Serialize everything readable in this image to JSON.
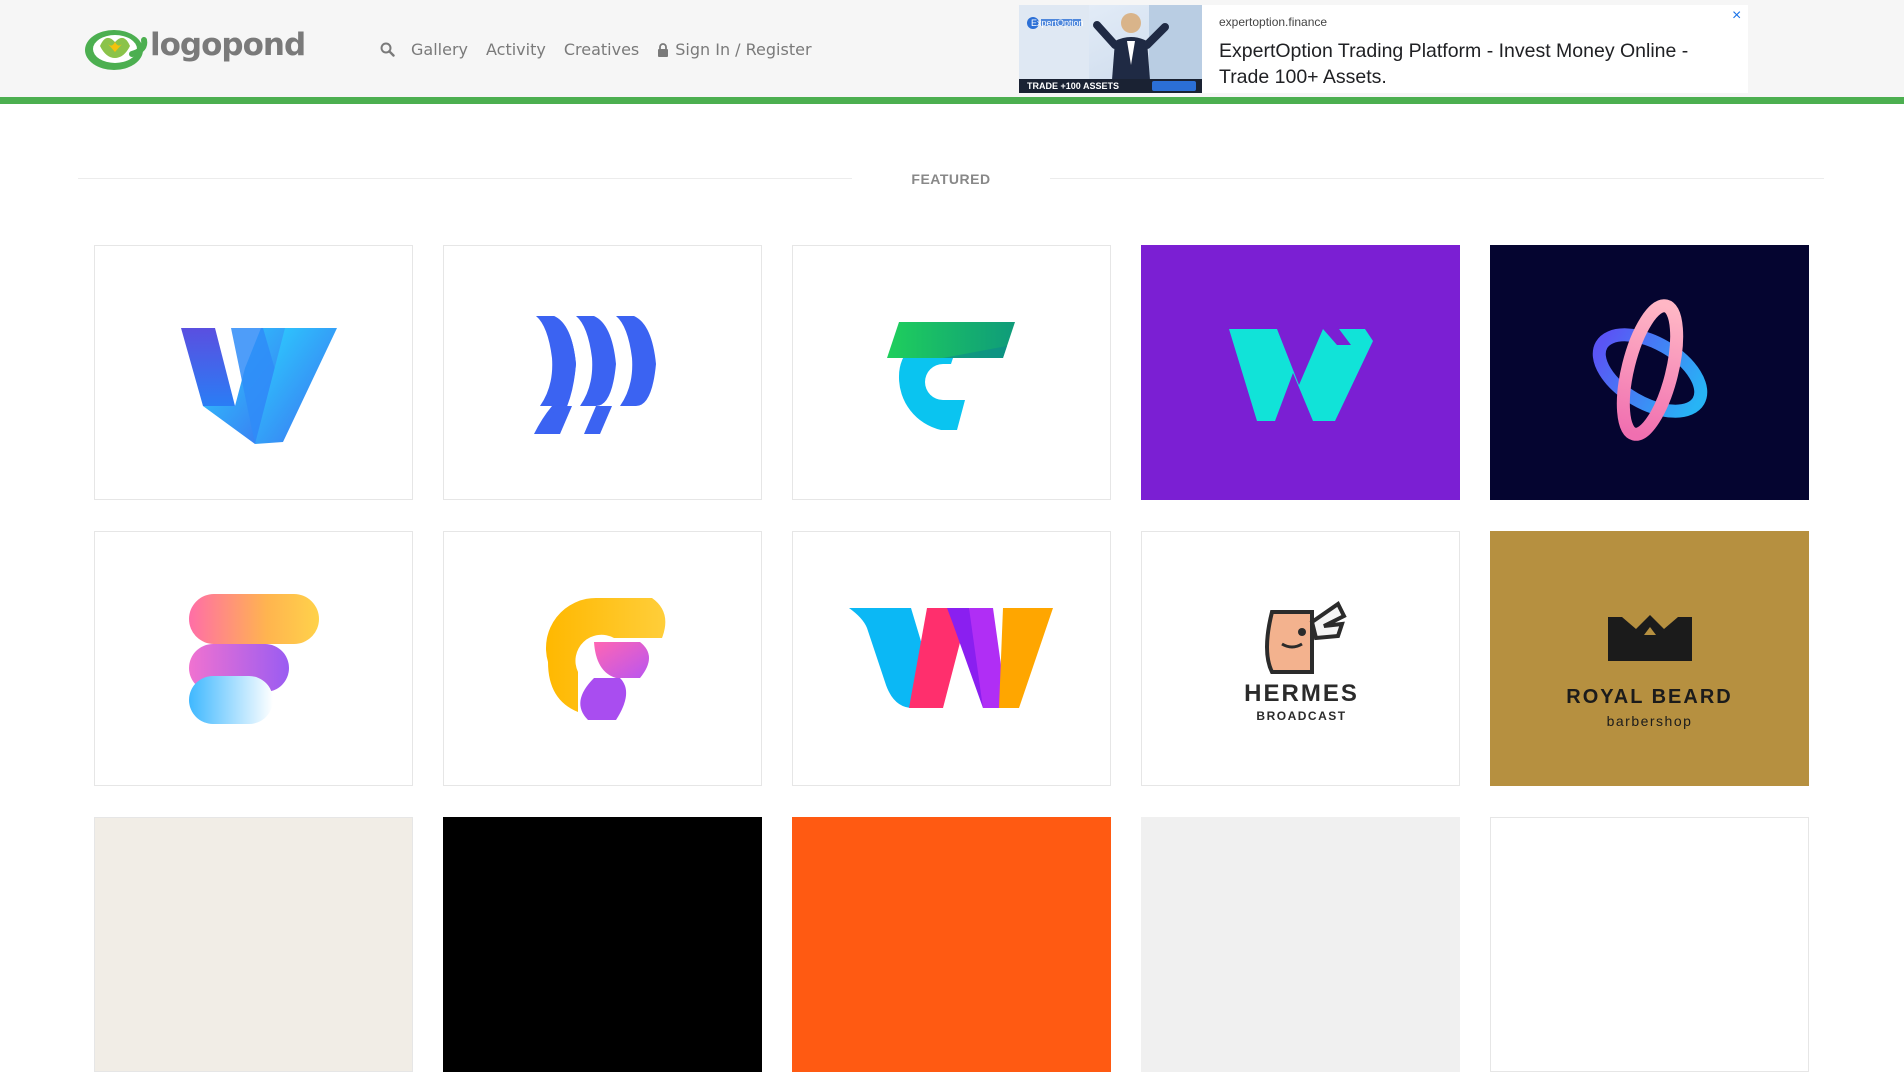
{
  "header": {
    "logo_text": "logopond",
    "nav": {
      "gallery": "Gallery",
      "activity": "Activity",
      "creatives": "Creatives",
      "sign_in": "Sign In / Register"
    },
    "accent_color": "#4caf50"
  },
  "ad": {
    "brand": "ExpertOption",
    "image_caption": "TRADE +100 ASSETS",
    "domain": "expertoption.finance",
    "title": "ExpertOption Trading Platform - Invest Money Online - Trade 100+ Assets.",
    "close_icon": "×"
  },
  "section": {
    "title": "FEATURED"
  },
  "logos": [
    {
      "name": "blue-w-ribbon-logo",
      "background": "#ffffff"
    },
    {
      "name": "blue-stripes-logo",
      "background": "#ffffff"
    },
    {
      "name": "green-cyan-c-logo",
      "background": "#ffffff"
    },
    {
      "name": "cyan-w-on-purple-logo",
      "background": "#7b1fd3"
    },
    {
      "name": "pink-blue-orbit-logo",
      "background": "#050530"
    },
    {
      "name": "gradient-f-logo",
      "background": "#ffffff"
    },
    {
      "name": "yellow-pink-f-logo",
      "background": "#ffffff"
    },
    {
      "name": "colorful-w-logo",
      "background": "#ffffff"
    },
    {
      "name": "hermes-broadcast-logo",
      "background": "#ffffff",
      "title": "HERMES",
      "subtitle": "BROADCAST"
    },
    {
      "name": "royal-beard-logo",
      "background": "#b69040",
      "title": "ROYAL BEARD",
      "subtitle": "barbershop"
    }
  ]
}
